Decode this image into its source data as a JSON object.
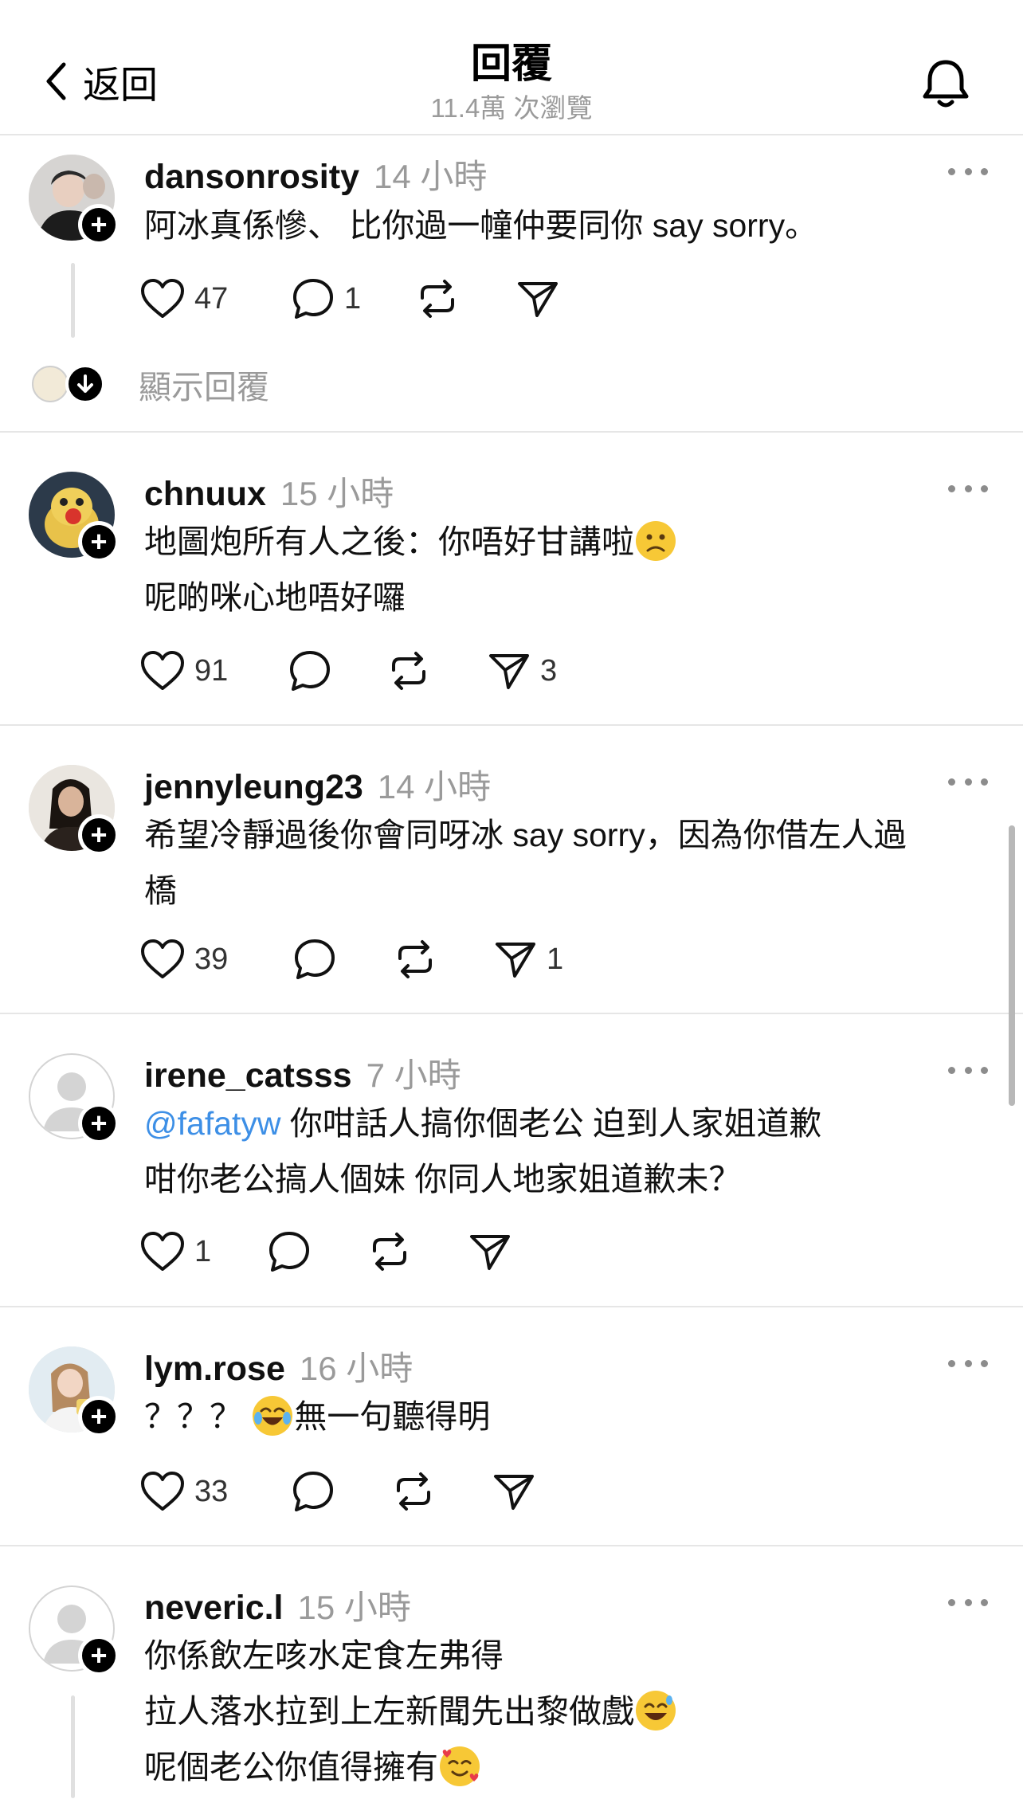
{
  "header": {
    "back_label": "返回",
    "title": "回覆",
    "views": "11.4萬 次瀏覽"
  },
  "comments": [
    {
      "username": "dansonrosity",
      "time": "14 小時",
      "lines": [
        "阿冰真係慘、 比你過一幢仲要同你 say sorry。"
      ],
      "likes": "47",
      "replies": "1",
      "reposts": "",
      "shares": "",
      "show_replies_label": "顯示回覆"
    },
    {
      "username": "chnuux",
      "time": "15 小時",
      "lines": [
        "地圖炮所有人之後：你唔好甘講啦",
        "呢啲咪心地唔好囉"
      ],
      "likes": "91",
      "replies": "",
      "reposts": "",
      "shares": "3"
    },
    {
      "username": "jennyleung23",
      "time": "14 小時",
      "lines": [
        "希望冷靜過後你會同呀冰 say sorry，因為你借左人過",
        "橋"
      ],
      "likes": "39",
      "replies": "",
      "reposts": "",
      "shares": "1"
    },
    {
      "username": "irene_catsss",
      "time": "7 小時",
      "mention": "@fafatyw",
      "lines": [
        " 你咁話人搞你個老公 迫到人家姐道歉",
        "咁你老公搞人個妹 你同人地家姐道歉未？"
      ],
      "likes": "1",
      "replies": "",
      "reposts": "",
      "shares": ""
    },
    {
      "username": "lym.rose",
      "time": "16 小時",
      "lines": [
        "？？？ ",
        "無一句聽得明"
      ],
      "likes": "33",
      "replies": "",
      "reposts": "",
      "shares": ""
    },
    {
      "username": "neveric.l",
      "time": "15 小時",
      "lines": [
        "你係飲左咳水定食左弗得",
        "拉人落水拉到上左新聞先出黎做戲",
        "呢個老公你值得擁有"
      ]
    }
  ]
}
